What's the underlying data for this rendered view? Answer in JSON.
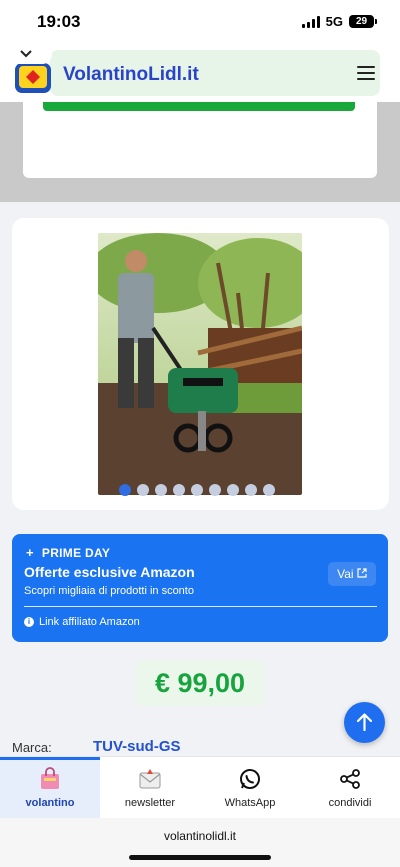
{
  "status_bar": {
    "time": "19:03",
    "network": "5G",
    "battery": "29"
  },
  "header": {
    "site_title": "VolantinoLidl.it",
    "collapse_icon": "chevron-down-icon",
    "menu_icon": "hamburger-icon"
  },
  "gallery": {
    "photo_count": 9,
    "active_index": 0
  },
  "amazon_banner": {
    "tag": "PRIME DAY",
    "title": "Offerte esclusive Amazon",
    "subtitle": "Scopri migliaia di prodotti in sconto",
    "button_label": "Vai",
    "link_label": "Link affiliato Amazon",
    "color": "#1a73f0"
  },
  "price": "€ 99,00",
  "brand": {
    "label": "Marca:",
    "value": "TUV-sud-GS"
  },
  "bottom_nav": [
    {
      "label": "volantino",
      "icon": "shopping-bag-icon",
      "active": true
    },
    {
      "label": "newsletter",
      "icon": "envelope-icon",
      "active": false
    },
    {
      "label": "WhatsApp",
      "icon": "whatsapp-icon",
      "active": false
    },
    {
      "label": "condividi",
      "icon": "share-icon",
      "active": false
    }
  ],
  "browser": {
    "url": "volantinolidl.it"
  },
  "colors": {
    "accent": "#1f6ef0",
    "price_green": "#17a33d",
    "brand_blue": "#2352d0"
  }
}
